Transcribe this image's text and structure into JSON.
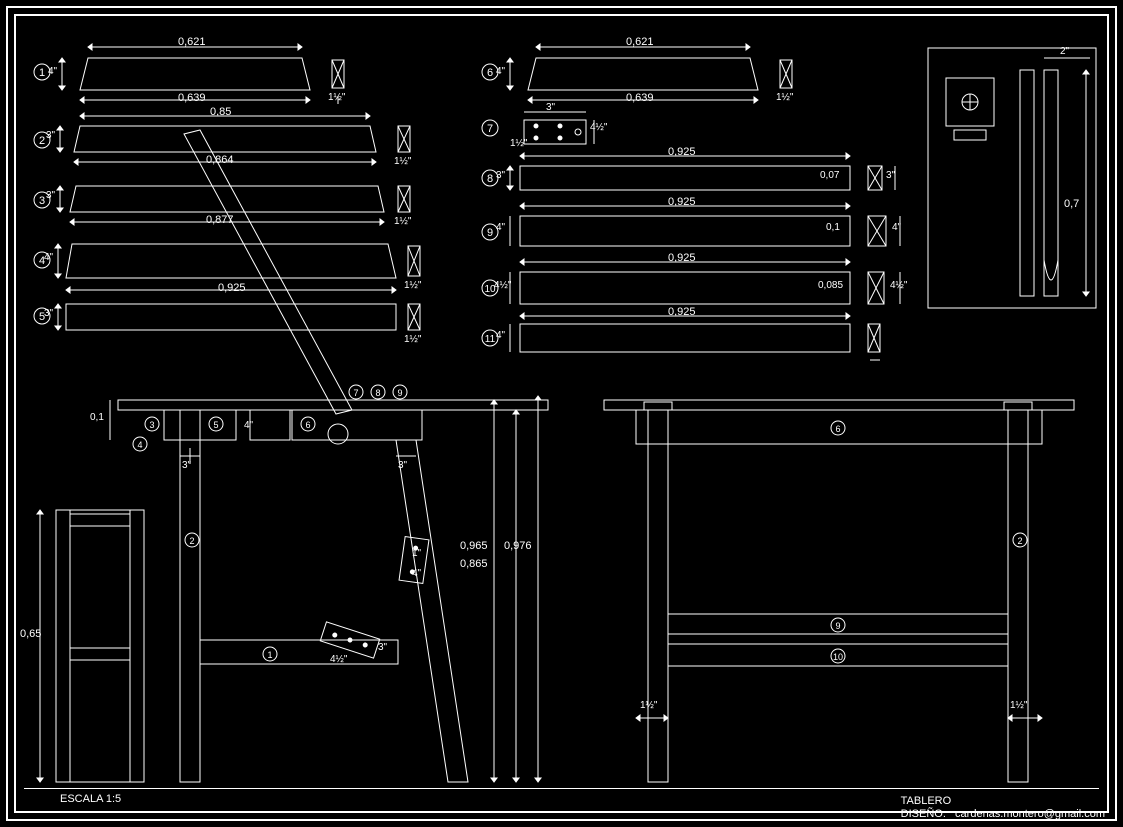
{
  "drawing": {
    "title": "TABLERO",
    "designer_label": "DISEÑO:",
    "designer_contact": "cardenas.montero@gmail.com",
    "scale_label": "ESCALA",
    "scale_value": "1:5"
  },
  "parts_top_left": [
    {
      "id": "1",
      "height": "4\"",
      "top_dim": "0,621",
      "bot_dim": "0,639",
      "section_h": "1½\""
    },
    {
      "id": "2",
      "height": "3\"",
      "top_dim": "0,85",
      "bot_dim": "0,864",
      "section_h": "1½\""
    },
    {
      "id": "3",
      "height": "3\"",
      "top_dim": "0,864",
      "bot_dim": "0,877",
      "section_h": "1½\""
    },
    {
      "id": "4",
      "height": "4\"",
      "top_dim": "0,877",
      "bot_dim": "0,925",
      "section_h": "1½\""
    },
    {
      "id": "5",
      "height": "3\"",
      "top_dim": "0,925",
      "bot_dim": "",
      "section_h": "1½\""
    }
  ],
  "parts_top_right": [
    {
      "id": "6",
      "height": "4\"",
      "top_dim": "0,621",
      "bot_dim": "0,639",
      "section_h": "1½\"",
      "extra": ""
    },
    {
      "id": "7",
      "height": "1½\"",
      "top_dim": "3\"",
      "bot_dim": "",
      "section_h": "4½\"",
      "extra": "plate"
    },
    {
      "id": "8",
      "height": "3\"",
      "top_dim": "0,925",
      "bot_dim": "0,925",
      "section_h": "3\"",
      "extra": "0,07"
    },
    {
      "id": "9",
      "height": "4\"",
      "top_dim": "0,925",
      "bot_dim": "0,925",
      "section_h": "4\"",
      "extra": "0,1"
    },
    {
      "id": "10",
      "height": "4½\"",
      "top_dim": "0,925",
      "bot_dim": "0,925",
      "section_h": "4½\"",
      "extra": "0,085"
    },
    {
      "id": "11",
      "height": "4\"",
      "top_dim": "0,925",
      "bot_dim": "",
      "section_h": "",
      "extra": ""
    }
  ],
  "detail_right": {
    "width": "2\"",
    "height": "0,7"
  },
  "assembly": {
    "side_view": {
      "table_height": "0,1",
      "leg_width": "3\"",
      "brace_width": "3\"",
      "apron_h": "4\"",
      "overall_h1": "0,965",
      "overall_h2": "0,865",
      "overall_h3": "0,976",
      "brace_plate_w": "4½\"",
      "brace_plate_h": "1\"",
      "brace_bottom": "3\"",
      "brace_top_off": "4\"",
      "callouts": [
        "1",
        "2",
        "3",
        "4",
        "5",
        "6",
        "7",
        "8",
        "9"
      ]
    },
    "aux_frame": {
      "height": "0,65"
    },
    "front_view": {
      "leg_offset_left": "1½\"",
      "leg_offset_right": "1½\"",
      "callouts": [
        "2",
        "6",
        "9",
        "10"
      ]
    }
  }
}
